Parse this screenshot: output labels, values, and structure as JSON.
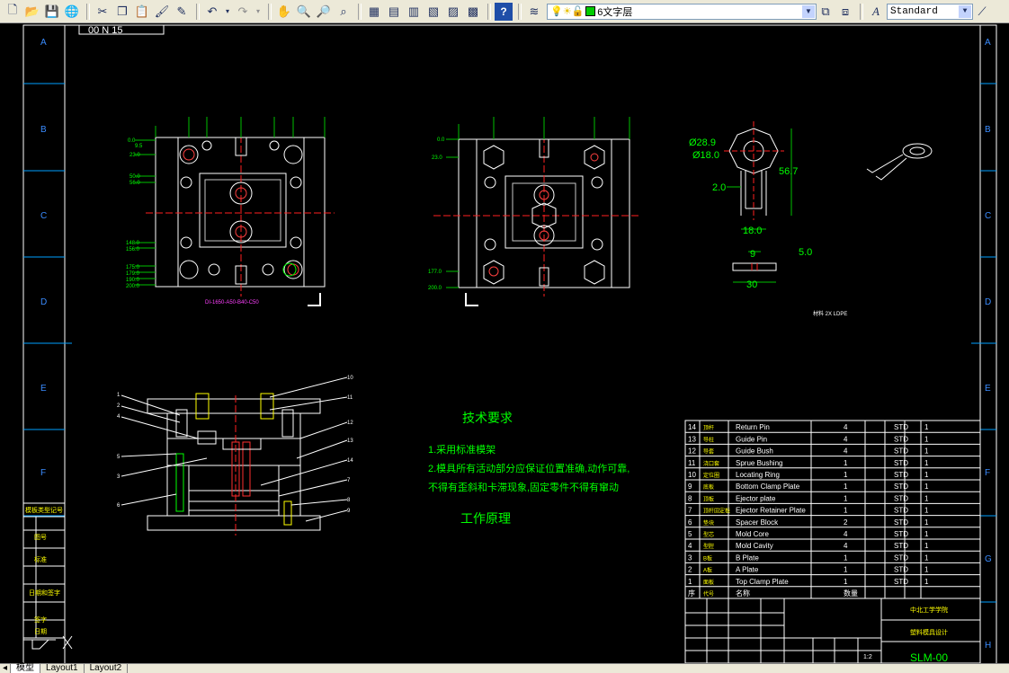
{
  "toolbar": {
    "layer_name": "6文字层",
    "text_style": "Standard"
  },
  "drawing": {
    "top_label": "00 N 15",
    "zone_letters": [
      "A",
      "B",
      "C",
      "D",
      "E",
      "F",
      "G",
      "H"
    ],
    "left_title_labels": [
      "模板类型记号",
      "图号",
      "标准",
      "日期和签字",
      "签字",
      "日期"
    ],
    "part_note": "DI-1650-A50-B40-C50",
    "tech_heading": "技术要求",
    "tech_lines": [
      "1.采用标准模架",
      "2.模具所有活动部分应保证位置准确,动作可靠,",
      "不得有歪斜和卡滞现象,固定零件不得有窜动"
    ],
    "work_heading": "工作原理",
    "ring_dims": {
      "d1": "Ø28.9",
      "d2": "Ø18.0",
      "w": "2.0",
      "h": "56.7",
      "b": "18.0"
    },
    "pin_dims": {
      "a": "9",
      "b": "5.0",
      "c": "30"
    },
    "small_note": "材料 2X LDPE",
    "dims_top_left": [
      "0.0",
      "9.5",
      "23.0",
      "50.0",
      "56.0",
      "148.0",
      "156.0",
      "175.0",
      "179.0",
      "190.0",
      "200.0"
    ],
    "dims_top_mid": [
      "0.0",
      "23.0",
      "177.0",
      "200.0"
    ],
    "bom_rows": [
      {
        "no": "14",
        "code": "顶杆",
        "name": "Return Pin",
        "qty": "4",
        "std": "STD",
        "n": "1"
      },
      {
        "no": "13",
        "code": "导柱",
        "name": "Guide Pin",
        "qty": "4",
        "std": "STD",
        "n": "1"
      },
      {
        "no": "12",
        "code": "导套",
        "name": "Guide Bush",
        "qty": "4",
        "std": "STD",
        "n": "1"
      },
      {
        "no": "11",
        "code": "浇口套",
        "name": "Sprue Bushing",
        "qty": "1",
        "std": "STD",
        "n": "1"
      },
      {
        "no": "10",
        "code": "定位圈",
        "name": "Locating Ring",
        "qty": "1",
        "std": "STD",
        "n": "1"
      },
      {
        "no": "9",
        "code": "底板",
        "name": "Bottom Clamp Plate",
        "qty": "1",
        "std": "STD",
        "n": "1"
      },
      {
        "no": "8",
        "code": "顶板",
        "name": "Ejector plate",
        "qty": "1",
        "std": "STD",
        "n": "1"
      },
      {
        "no": "7",
        "code": "顶杆固定板",
        "name": "Ejector Retainer Plate",
        "qty": "1",
        "std": "STD",
        "n": "1"
      },
      {
        "no": "6",
        "code": "垫块",
        "name": "Spacer Block",
        "qty": "2",
        "std": "STD",
        "n": "1"
      },
      {
        "no": "5",
        "code": "型芯",
        "name": "Mold Core",
        "qty": "4",
        "std": "STD",
        "n": "1"
      },
      {
        "no": "4",
        "code": "型腔",
        "name": "Mold Cavity",
        "qty": "4",
        "std": "STD",
        "n": "1"
      },
      {
        "no": "3",
        "code": "B板",
        "name": "B Plate",
        "qty": "1",
        "std": "STD",
        "n": "1"
      },
      {
        "no": "2",
        "code": "A板",
        "name": "A Plate",
        "qty": "1",
        "std": "STD",
        "n": "1"
      },
      {
        "no": "1",
        "code": "面板",
        "name": "Top Clamp Plate",
        "qty": "1",
        "std": "STD",
        "n": "1"
      },
      {
        "no": "序",
        "code": "代号",
        "name": "名称",
        "qty": "数量",
        "std": "",
        "n": ""
      }
    ],
    "title_block": {
      "school": "中北工学学院",
      "title": "塑料模具设计",
      "drawing_no": "SLM-00",
      "scale": "1:2"
    }
  },
  "tabs": {
    "model": "模型",
    "layout1": "Layout1",
    "layout2": "Layout2"
  }
}
